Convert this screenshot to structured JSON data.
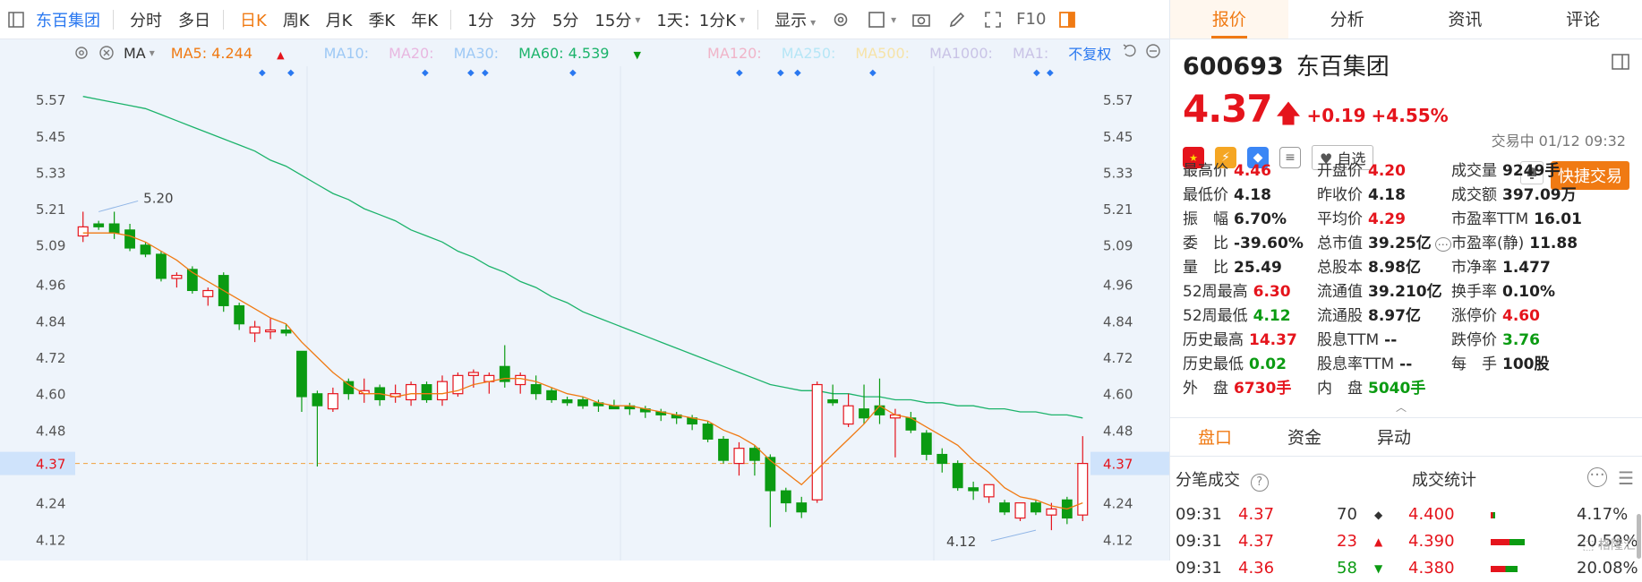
{
  "toolbar": {
    "items": [
      {
        "label": "东百集团",
        "type": "brand"
      },
      {
        "label": "分时"
      },
      {
        "label": "多日"
      },
      {
        "label": "日K",
        "active": true
      },
      {
        "label": "周K"
      },
      {
        "label": "月K"
      },
      {
        "label": "季K"
      },
      {
        "label": "年K"
      },
      {
        "label": "1分"
      },
      {
        "label": "3分"
      },
      {
        "label": "5分"
      },
      {
        "label": "15分"
      },
      {
        "label": "1天：1分K"
      }
    ],
    "display_label": "显示",
    "f10_label": "F10"
  },
  "ma_bar": {
    "title": "MA",
    "ma5": "MA5: 4.244",
    "ma10": "MA10:",
    "ma20": "MA20:",
    "ma30": "MA30:",
    "ma60": "MA60: 4.539",
    "ma120": "MA120:",
    "ma250": "MA250:",
    "ma500": "MA500:",
    "ma1000": "MA1000:",
    "ma1": "MA1:",
    "adjust": "不复权",
    "colors": {
      "ma5": "#f07a13",
      "ma60": "#1cb36b",
      "faint": "#c9c3e6",
      "faint2": "#9ec9f5",
      "faint3": "#f6e3a8"
    }
  },
  "chart_data": {
    "type": "candlestick",
    "y_ticks": [
      "5.57",
      "5.45",
      "5.33",
      "5.21",
      "5.09",
      "4.96",
      "4.84",
      "4.72",
      "4.60",
      "4.48",
      "4.37",
      "4.24",
      "4.12"
    ],
    "current_price_label": "4.37",
    "high_annotation": "5.20",
    "low_annotation": "4.12",
    "candles": [
      {
        "o": 5.15,
        "h": 5.2,
        "l": 5.1,
        "c": 5.12,
        "dir": "up"
      },
      {
        "o": 5.16,
        "h": 5.17,
        "l": 5.14,
        "c": 5.15,
        "dir": "down"
      },
      {
        "o": 5.16,
        "h": 5.2,
        "l": 5.11,
        "c": 5.13,
        "dir": "down"
      },
      {
        "o": 5.14,
        "h": 5.16,
        "l": 5.07,
        "c": 5.08,
        "dir": "down"
      },
      {
        "o": 5.09,
        "h": 5.1,
        "l": 5.05,
        "c": 5.06,
        "dir": "down"
      },
      {
        "o": 5.06,
        "h": 5.07,
        "l": 4.97,
        "c": 4.98,
        "dir": "down"
      },
      {
        "o": 4.98,
        "h": 5.0,
        "l": 4.95,
        "c": 4.99,
        "dir": "up"
      },
      {
        "o": 5.01,
        "h": 5.02,
        "l": 4.93,
        "c": 4.94,
        "dir": "down"
      },
      {
        "o": 4.92,
        "h": 4.95,
        "l": 4.89,
        "c": 4.94,
        "dir": "up"
      },
      {
        "o": 4.99,
        "h": 5.0,
        "l": 4.87,
        "c": 4.89,
        "dir": "down"
      },
      {
        "o": 4.89,
        "h": 4.9,
        "l": 4.81,
        "c": 4.83,
        "dir": "down"
      },
      {
        "o": 4.8,
        "h": 4.84,
        "l": 4.77,
        "c": 4.82,
        "dir": "up"
      },
      {
        "o": 4.81,
        "h": 4.85,
        "l": 4.78,
        "c": 4.81,
        "dir": "up"
      },
      {
        "o": 4.81,
        "h": 4.83,
        "l": 4.79,
        "c": 4.8,
        "dir": "down"
      },
      {
        "o": 4.74,
        "h": 4.74,
        "l": 4.54,
        "c": 4.59,
        "dir": "down"
      },
      {
        "o": 4.6,
        "h": 4.61,
        "l": 4.36,
        "c": 4.56,
        "dir": "down"
      },
      {
        "o": 4.55,
        "h": 4.62,
        "l": 4.54,
        "c": 4.6,
        "dir": "up"
      },
      {
        "o": 4.64,
        "h": 4.65,
        "l": 4.58,
        "c": 4.6,
        "dir": "down"
      },
      {
        "o": 4.6,
        "h": 4.65,
        "l": 4.57,
        "c": 4.61,
        "dir": "up"
      },
      {
        "o": 4.62,
        "h": 4.63,
        "l": 4.56,
        "c": 4.58,
        "dir": "down"
      },
      {
        "o": 4.59,
        "h": 4.63,
        "l": 4.57,
        "c": 4.6,
        "dir": "up"
      },
      {
        "o": 4.58,
        "h": 4.64,
        "l": 4.56,
        "c": 4.63,
        "dir": "up"
      },
      {
        "o": 4.63,
        "h": 4.64,
        "l": 4.57,
        "c": 4.58,
        "dir": "down"
      },
      {
        "o": 4.58,
        "h": 4.66,
        "l": 4.56,
        "c": 4.64,
        "dir": "up"
      },
      {
        "o": 4.6,
        "h": 4.67,
        "l": 4.59,
        "c": 4.66,
        "dir": "up"
      },
      {
        "o": 4.66,
        "h": 4.68,
        "l": 4.62,
        "c": 4.67,
        "dir": "up"
      },
      {
        "o": 4.64,
        "h": 4.67,
        "l": 4.6,
        "c": 4.66,
        "dir": "up"
      },
      {
        "o": 4.69,
        "h": 4.76,
        "l": 4.62,
        "c": 4.64,
        "dir": "down"
      },
      {
        "o": 4.66,
        "h": 4.67,
        "l": 4.6,
        "c": 4.63,
        "dir": "up"
      },
      {
        "o": 4.63,
        "h": 4.66,
        "l": 4.58,
        "c": 4.6,
        "dir": "down"
      },
      {
        "o": 4.61,
        "h": 4.62,
        "l": 4.57,
        "c": 4.58,
        "dir": "down"
      },
      {
        "o": 4.58,
        "h": 4.59,
        "l": 4.56,
        "c": 4.57,
        "dir": "down"
      },
      {
        "o": 4.58,
        "h": 4.59,
        "l": 4.55,
        "c": 4.56,
        "dir": "down"
      },
      {
        "o": 4.57,
        "h": 4.58,
        "l": 4.54,
        "c": 4.56,
        "dir": "down"
      },
      {
        "o": 4.56,
        "h": 4.58,
        "l": 4.55,
        "c": 4.55,
        "dir": "down"
      },
      {
        "o": 4.56,
        "h": 4.57,
        "l": 4.53,
        "c": 4.55,
        "dir": "down"
      },
      {
        "o": 4.55,
        "h": 4.56,
        "l": 4.52,
        "c": 4.54,
        "dir": "down"
      },
      {
        "o": 4.54,
        "h": 4.55,
        "l": 4.51,
        "c": 4.53,
        "dir": "down"
      },
      {
        "o": 4.53,
        "h": 4.54,
        "l": 4.5,
        "c": 4.52,
        "dir": "down"
      },
      {
        "o": 4.52,
        "h": 4.53,
        "l": 4.48,
        "c": 4.5,
        "dir": "down"
      },
      {
        "o": 4.5,
        "h": 4.51,
        "l": 4.44,
        "c": 4.45,
        "dir": "down"
      },
      {
        "o": 4.45,
        "h": 4.46,
        "l": 4.37,
        "c": 4.38,
        "dir": "down"
      },
      {
        "o": 4.37,
        "h": 4.44,
        "l": 4.33,
        "c": 4.42,
        "dir": "up"
      },
      {
        "o": 4.42,
        "h": 4.43,
        "l": 4.33,
        "c": 4.38,
        "dir": "down"
      },
      {
        "o": 4.39,
        "h": 4.4,
        "l": 4.16,
        "c": 4.28,
        "dir": "down"
      },
      {
        "o": 4.28,
        "h": 4.29,
        "l": 4.21,
        "c": 4.24,
        "dir": "down"
      },
      {
        "o": 4.24,
        "h": 4.26,
        "l": 4.19,
        "c": 4.21,
        "dir": "down"
      },
      {
        "o": 4.25,
        "h": 4.64,
        "l": 4.24,
        "c": 4.63,
        "dir": "up"
      },
      {
        "o": 4.57,
        "h": 4.63,
        "l": 4.56,
        "c": 4.58,
        "dir": "down"
      },
      {
        "o": 4.5,
        "h": 4.6,
        "l": 4.49,
        "c": 4.56,
        "dir": "up"
      },
      {
        "o": 4.55,
        "h": 4.63,
        "l": 4.5,
        "c": 4.52,
        "dir": "down"
      },
      {
        "o": 4.56,
        "h": 4.65,
        "l": 4.5,
        "c": 4.53,
        "dir": "down"
      },
      {
        "o": 4.52,
        "h": 4.55,
        "l": 4.39,
        "c": 4.53,
        "dir": "up"
      },
      {
        "o": 4.52,
        "h": 4.54,
        "l": 4.47,
        "c": 4.48,
        "dir": "down"
      },
      {
        "o": 4.47,
        "h": 4.48,
        "l": 4.38,
        "c": 4.4,
        "dir": "down"
      },
      {
        "o": 4.4,
        "h": 4.42,
        "l": 4.34,
        "c": 4.37,
        "dir": "down"
      },
      {
        "o": 4.37,
        "h": 4.38,
        "l": 4.28,
        "c": 4.29,
        "dir": "down"
      },
      {
        "o": 4.29,
        "h": 4.31,
        "l": 4.25,
        "c": 4.28,
        "dir": "down"
      },
      {
        "o": 4.26,
        "h": 4.3,
        "l": 4.24,
        "c": 4.3,
        "dir": "up"
      },
      {
        "o": 4.24,
        "h": 4.25,
        "l": 4.2,
        "c": 4.21,
        "dir": "down"
      },
      {
        "o": 4.19,
        "h": 4.24,
        "l": 4.18,
        "c": 4.24,
        "dir": "up"
      },
      {
        "o": 4.24,
        "h": 4.25,
        "l": 4.2,
        "c": 4.21,
        "dir": "down"
      },
      {
        "o": 4.2,
        "h": 4.24,
        "l": 4.15,
        "c": 4.22,
        "dir": "up"
      },
      {
        "o": 4.25,
        "h": 4.26,
        "l": 4.17,
        "c": 4.19,
        "dir": "down"
      },
      {
        "o": 4.2,
        "h": 4.46,
        "l": 4.18,
        "c": 4.37,
        "dir": "up"
      }
    ],
    "ma5_series": [
      5.13,
      5.13,
      5.13,
      5.12,
      5.1,
      5.07,
      5.04,
      5.0,
      4.97,
      4.94,
      4.91,
      4.88,
      4.85,
      4.83,
      4.77,
      4.72,
      4.67,
      4.63,
      4.6,
      4.6,
      4.59,
      4.6,
      4.6,
      4.6,
      4.61,
      4.63,
      4.64,
      4.65,
      4.65,
      4.64,
      4.62,
      4.6,
      4.59,
      4.57,
      4.56,
      4.56,
      4.55,
      4.54,
      4.53,
      4.52,
      4.51,
      4.48,
      4.46,
      4.43,
      4.38,
      4.34,
      4.3,
      4.35,
      4.4,
      4.45,
      4.5,
      4.56,
      4.53,
      4.52,
      4.49,
      4.46,
      4.43,
      4.38,
      4.34,
      4.29,
      4.26,
      4.25,
      4.23,
      4.22,
      4.24
    ],
    "ma60_series": [
      5.58,
      5.57,
      5.56,
      5.55,
      5.54,
      5.52,
      5.5,
      5.48,
      5.46,
      5.44,
      5.42,
      5.4,
      5.37,
      5.35,
      5.32,
      5.29,
      5.26,
      5.24,
      5.21,
      5.19,
      5.17,
      5.14,
      5.12,
      5.1,
      5.07,
      5.05,
      5.02,
      5.0,
      4.97,
      4.95,
      4.92,
      4.9,
      4.87,
      4.85,
      4.83,
      4.81,
      4.79,
      4.77,
      4.75,
      4.73,
      4.71,
      4.69,
      4.67,
      4.65,
      4.63,
      4.62,
      4.61,
      4.61,
      4.6,
      4.6,
      4.59,
      4.59,
      4.58,
      4.58,
      4.57,
      4.57,
      4.56,
      4.56,
      4.55,
      4.55,
      4.54,
      4.54,
      4.53,
      4.53,
      4.52
    ],
    "ylim": [
      4.05,
      5.65
    ],
    "colors": {
      "up": "#e5141c",
      "down": "#0b9b12",
      "ma5": "#f07a13",
      "ma60": "#1cb36b"
    }
  },
  "quote": {
    "tabs": [
      "报价",
      "分析",
      "资讯",
      "评论"
    ],
    "code": "600693",
    "name": "东百集团",
    "price": "4.37",
    "change": "+0.19",
    "change_pct": "+4.55%",
    "status": "交易中 01/12 09:32",
    "watch_label": "自选",
    "fast_trade_label": "快捷交易",
    "stats": [
      [
        {
          "label": "最高价",
          "value": "4.46",
          "color": "red"
        },
        {
          "label": "最低价",
          "value": "4.18",
          "color": "black"
        },
        {
          "label": "振　幅",
          "value": "6.70%",
          "color": "black"
        },
        {
          "label": "委　比",
          "value": "-39.60%",
          "color": "black"
        },
        {
          "label": "量　比",
          "value": "25.49",
          "color": "black"
        },
        {
          "label": "52周最高",
          "value": "6.30",
          "color": "red"
        },
        {
          "label": "52周最低",
          "value": "4.12",
          "color": "green"
        },
        {
          "label": "历史最高",
          "value": "14.37",
          "color": "red"
        },
        {
          "label": "历史最低",
          "value": "0.02",
          "color": "green"
        },
        {
          "label": "外　盘",
          "value": "6730手",
          "color": "red"
        }
      ],
      [
        {
          "label": "开盘价",
          "value": "4.20",
          "color": "red"
        },
        {
          "label": "昨收价",
          "value": "4.18",
          "color": "black"
        },
        {
          "label": "平均价",
          "value": "4.29",
          "color": "red"
        },
        {
          "label": "总市值",
          "value": "39.25亿",
          "color": "black"
        },
        {
          "label": "总股本",
          "value": "8.98亿",
          "color": "black"
        },
        {
          "label": "流通值",
          "value": "39.210亿",
          "color": "black"
        },
        {
          "label": "流通股",
          "value": "8.97亿",
          "color": "black"
        },
        {
          "label": "股息TTM",
          "value": "--",
          "color": "black"
        },
        {
          "label": "股息率TTM",
          "value": "--",
          "color": "black"
        },
        {
          "label": "内　盘",
          "value": "5040手",
          "color": "green"
        }
      ],
      [
        {
          "label": "成交量",
          "value": "9249手",
          "color": "black"
        },
        {
          "label": "成交额",
          "value": "397.09万",
          "color": "black"
        },
        {
          "label": "市盈率TTM",
          "value": "16.01",
          "color": "black"
        },
        {
          "label": "市盈率(静)",
          "value": "11.88",
          "color": "black"
        },
        {
          "label": "市净率",
          "value": "1.477",
          "color": "black"
        },
        {
          "label": "换手率",
          "value": "0.10%",
          "color": "black"
        },
        {
          "label": "涨停价",
          "value": "4.60",
          "color": "red"
        },
        {
          "label": "跌停价",
          "value": "3.76",
          "color": "green"
        },
        {
          "label": "每　手",
          "value": "100股",
          "color": "black"
        }
      ]
    ],
    "subtabs": [
      "盘口",
      "资金",
      "异动"
    ],
    "ticks_title": "分笔成交",
    "stat_title": "成交统计",
    "ticks": [
      {
        "time": "09:31",
        "price": "4.37",
        "vol": "70",
        "mark": "◆",
        "mark_color": "#333"
      },
      {
        "time": "09:31",
        "price": "4.37",
        "vol": "23",
        "mark": "▲",
        "mark_color": "#e5141c"
      },
      {
        "time": "09:31",
        "price": "4.36",
        "vol": "58",
        "mark": "▼",
        "mark_color": "#0b9b12"
      }
    ],
    "distribution": [
      {
        "price": "4.400",
        "pct": "4.17%",
        "fill": 0.05
      },
      {
        "price": "4.390",
        "pct": "20.59%",
        "fill": 0.38
      },
      {
        "price": "4.380",
        "pct": "20.08%",
        "fill": 0.3
      }
    ]
  }
}
